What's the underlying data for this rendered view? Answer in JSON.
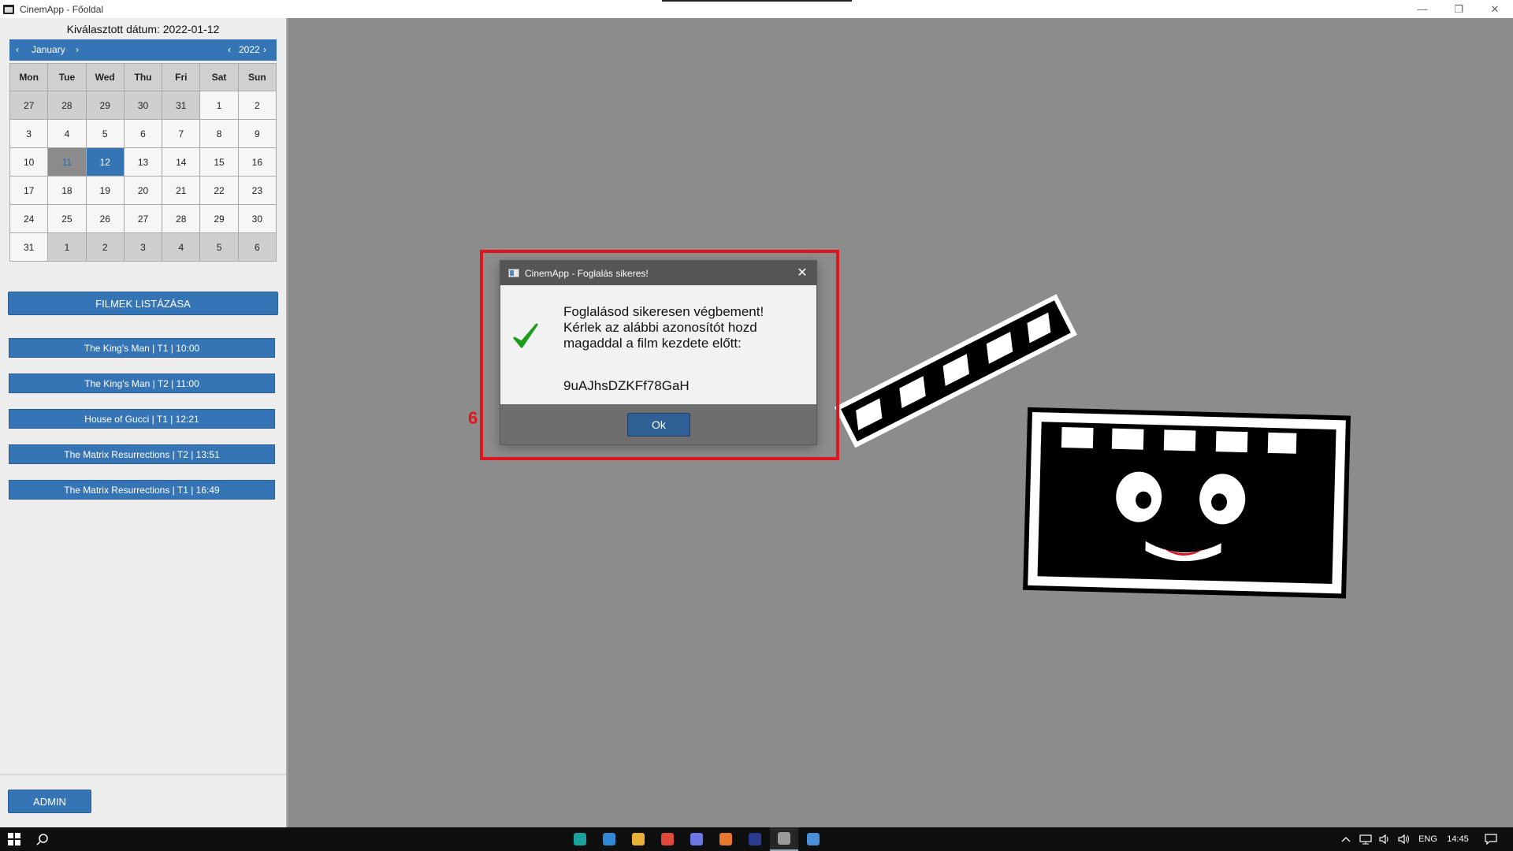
{
  "window": {
    "title": "CinemApp - Főoldal",
    "minimize": "—",
    "restore": "❐",
    "close": "✕"
  },
  "sidebar": {
    "selected_date_label": "Kiválasztott dátum: 2022-01-12",
    "calendar": {
      "prev_month": "‹",
      "month": "January",
      "next_month": "›",
      "prev_year": "‹",
      "year": "2022",
      "next_year": "›",
      "weekdays": [
        "Mon",
        "Tue",
        "Wed",
        "Thu",
        "Fri",
        "Sat",
        "Sun"
      ],
      "days": [
        {
          "label": "27",
          "state": "other"
        },
        {
          "label": "28",
          "state": "other"
        },
        {
          "label": "29",
          "state": "other"
        },
        {
          "label": "30",
          "state": "other"
        },
        {
          "label": "31",
          "state": "other"
        },
        {
          "label": "1",
          "state": ""
        },
        {
          "label": "2",
          "state": ""
        },
        {
          "label": "3",
          "state": ""
        },
        {
          "label": "4",
          "state": ""
        },
        {
          "label": "5",
          "state": ""
        },
        {
          "label": "6",
          "state": ""
        },
        {
          "label": "7",
          "state": ""
        },
        {
          "label": "8",
          "state": ""
        },
        {
          "label": "9",
          "state": ""
        },
        {
          "label": "10",
          "state": ""
        },
        {
          "label": "11",
          "state": "today"
        },
        {
          "label": "12",
          "state": "selected"
        },
        {
          "label": "13",
          "state": ""
        },
        {
          "label": "14",
          "state": ""
        },
        {
          "label": "15",
          "state": ""
        },
        {
          "label": "16",
          "state": ""
        },
        {
          "label": "17",
          "state": ""
        },
        {
          "label": "18",
          "state": ""
        },
        {
          "label": "19",
          "state": ""
        },
        {
          "label": "20",
          "state": ""
        },
        {
          "label": "21",
          "state": ""
        },
        {
          "label": "22",
          "state": ""
        },
        {
          "label": "23",
          "state": ""
        },
        {
          "label": "24",
          "state": ""
        },
        {
          "label": "25",
          "state": ""
        },
        {
          "label": "26",
          "state": ""
        },
        {
          "label": "27",
          "state": ""
        },
        {
          "label": "28",
          "state": ""
        },
        {
          "label": "29",
          "state": ""
        },
        {
          "label": "30",
          "state": ""
        },
        {
          "label": "31",
          "state": ""
        },
        {
          "label": "1",
          "state": "other"
        },
        {
          "label": "2",
          "state": "other"
        },
        {
          "label": "3",
          "state": "other"
        },
        {
          "label": "4",
          "state": "other"
        },
        {
          "label": "5",
          "state": "other"
        },
        {
          "label": "6",
          "state": "other"
        }
      ]
    },
    "list_movies_button": "FILMEK LISTÁZÁSA",
    "screenings": [
      "The King's Man | T1 | 10:00",
      "The King's Man | T2 | 11:00",
      "House of Gucci | T1 | 12:21",
      "The Matrix Resurrections | T2 | 13:51",
      "The Matrix Resurrections | T1 | 16:49"
    ],
    "admin_button": "ADMIN"
  },
  "dialog": {
    "title": "CinemApp - Foglalás sikeres!",
    "close": "✕",
    "message_lines": [
      "Foglalásod sikeresen végbement!",
      "Kérlek az alábbi azonosítót hozd",
      "magaddal a film kezdete előtt:"
    ],
    "booking_code": "9uAJhsDZKFf78GaH",
    "ok_button": "Ok"
  },
  "annotation": {
    "number": "6"
  },
  "taskbar": {
    "language": "ENG",
    "time": "14:45",
    "apps": [
      {
        "name": "browser-app-icon",
        "color": "#1aa39a"
      },
      {
        "name": "vscode-icon",
        "color": "#2f88d6"
      },
      {
        "name": "file-explorer-icon",
        "color": "#e8b13a"
      },
      {
        "name": "chrome-icon",
        "color": "#e04a3b"
      },
      {
        "name": "discord-icon",
        "color": "#6b76e6"
      },
      {
        "name": "orange-app-icon",
        "color": "#e8782e"
      },
      {
        "name": "intellij-icon",
        "color": "#2b3b8f"
      },
      {
        "name": "cinemapp-taskbar-icon",
        "color": "#9a9a9a"
      },
      {
        "name": "java-app-icon",
        "color": "#4a90d9"
      }
    ]
  },
  "colors": {
    "accent": "#3675b5",
    "annotation": "#e0161e",
    "check": "#1b9e1b"
  }
}
